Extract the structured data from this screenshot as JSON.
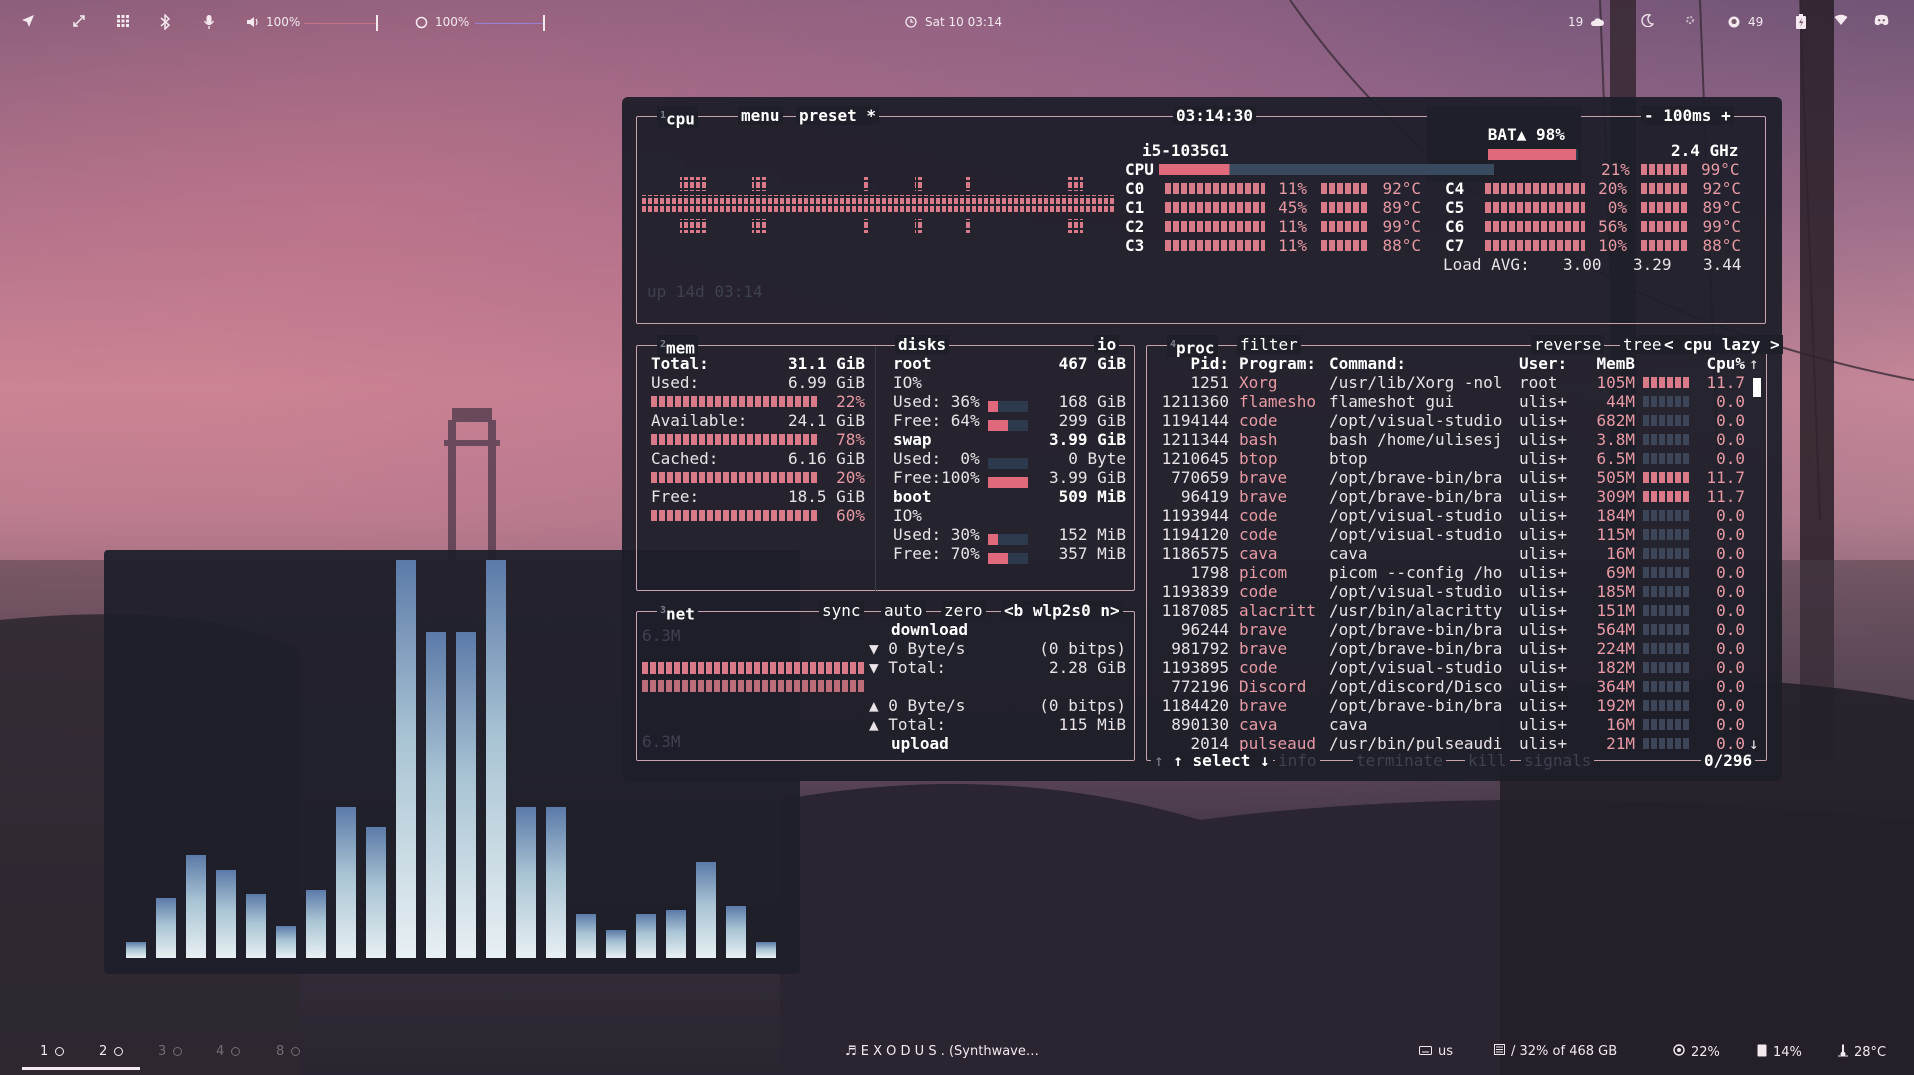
{
  "topbar": {
    "left_icons": [
      "location-arrow-icon",
      "expand-icon",
      "grid-icon",
      "bluetooth-icon",
      "microphone-icon"
    ],
    "volume": {
      "icon": "speaker-icon",
      "label": "100%",
      "level": 1.0,
      "color": "#c6738a"
    },
    "brightness": {
      "icon": "brightness-icon",
      "label": "100%",
      "level": 1.0,
      "color": "#9b7fd6"
    },
    "clock": {
      "icon": "clock-icon",
      "label": "Sat 10 03:14"
    },
    "right": {
      "weather_count": "19",
      "weather_icon": "cloud-icon",
      "moon_icon": "moon-icon",
      "settings_icon": "gear-icon",
      "github_icon": "github-icon",
      "github_count": "49",
      "battery_icon": "battery-charging-icon",
      "wifi_icon": "wifi-icon",
      "discord_icon": "discord-icon"
    }
  },
  "btop": {
    "cpu_box": {
      "title_num": "1",
      "title": "cpu",
      "menu": "menu",
      "preset": "preset *",
      "time": "03:14:30",
      "battery_label": "BAT▲ 98%",
      "battery_level": 0.98,
      "interval": "- 100ms +",
      "uptime": "up 14d 03:14",
      "cpu_model": "i5-1035G1",
      "freq": "2.4 GHz",
      "cpu_label": "CPU",
      "cpu_pct": "21%",
      "cpu_level": 0.21,
      "cpu_temp": "99°C",
      "cores": [
        {
          "name": "C0",
          "pct": "11%",
          "temp": "92°C"
        },
        {
          "name": "C1",
          "pct": "45%",
          "temp": "89°C"
        },
        {
          "name": "C2",
          "pct": "11%",
          "temp": "99°C"
        },
        {
          "name": "C3",
          "pct": "11%",
          "temp": "88°C"
        },
        {
          "name": "C4",
          "pct": "20%",
          "temp": "92°C"
        },
        {
          "name": "C5",
          "pct": "0%",
          "temp": "89°C"
        },
        {
          "name": "C6",
          "pct": "56%",
          "temp": "99°C"
        },
        {
          "name": "C7",
          "pct": "10%",
          "temp": "88°C"
        }
      ],
      "load_label": "Load AVG:",
      "load": [
        "3.00",
        "3.29",
        "3.44"
      ]
    },
    "mem_box": {
      "title_num": "2",
      "title": "mem",
      "rows": [
        {
          "label": "Total:",
          "value": "31.1 GiB",
          "pct": ""
        },
        {
          "label": "Used:",
          "value": "6.99 GiB",
          "pct": "22%"
        },
        {
          "label": "Available:",
          "value": "24.1 GiB",
          "pct": "78%"
        },
        {
          "label": "Cached:",
          "value": "6.16 GiB",
          "pct": "20%"
        },
        {
          "label": "Free:",
          "value": "18.5 GiB",
          "pct": "60%"
        }
      ]
    },
    "disks_box": {
      "title": "disks",
      "io": "io",
      "root": {
        "name": "root",
        "size": "467 GiB",
        "io": "IO%",
        "used": "Used: 36%",
        "used_val": "168 GiB",
        "free": "Free: 64%",
        "free_val": "299 GiB"
      },
      "swap": {
        "name": "swap",
        "size": "3.99 GiB",
        "used": "Used:  0%",
        "used_val": "0 Byte",
        "free": "Free:100%",
        "free_val": "3.99 GiB"
      },
      "boot": {
        "name": "boot",
        "size": "509 MiB",
        "io": "IO%",
        "used": "Used: 30%",
        "used_val": "152 MiB",
        "free": "Free: 70%",
        "free_val": "357 MiB"
      }
    },
    "net_box": {
      "title_num": "3",
      "title": "net",
      "sync": "sync",
      "auto": "auto",
      "zero": "zero",
      "iface": "<b wlp2s0 n>",
      "scale_top": "6.3M",
      "scale_bottom": "6.3M",
      "download": "download",
      "dl_rate": "▼ 0 Byte/s",
      "dl_bits": "(0 bitps)",
      "dl_total_label": "▼ Total:",
      "dl_total": "2.28 GiB",
      "ul_rate": "▲ 0 Byte/s",
      "ul_bits": "(0 bitps)",
      "ul_total_label": "▲ Total:",
      "ul_total": "115 MiB",
      "upload": "upload"
    },
    "proc_box": {
      "title_num": "4",
      "title": "proc",
      "filter": "filter",
      "reverse": "reverse",
      "tree": "tree",
      "sort": "< cpu lazy >",
      "headers": [
        "Pid:",
        "Program:",
        "Command:",
        "User:",
        "MemB",
        "Cpu%"
      ],
      "rows": [
        {
          "pid": "1251",
          "prog": "Xorg",
          "cmd": "/usr/lib/Xorg -nol",
          "user": "root",
          "mem": "105M",
          "cpu": "11.7"
        },
        {
          "pid": "1211360",
          "prog": "flamesho",
          "cmd": "flameshot gui",
          "user": "ulis+",
          "mem": "44M",
          "cpu": "0.0"
        },
        {
          "pid": "1194144",
          "prog": "code",
          "cmd": "/opt/visual-studio",
          "user": "ulis+",
          "mem": "682M",
          "cpu": "0.0"
        },
        {
          "pid": "1211344",
          "prog": "bash",
          "cmd": "bash /home/ulisesj",
          "user": "ulis+",
          "mem": "3.8M",
          "cpu": "0.0"
        },
        {
          "pid": "1210645",
          "prog": "btop",
          "cmd": "btop",
          "user": "ulis+",
          "mem": "6.5M",
          "cpu": "0.0"
        },
        {
          "pid": "770659",
          "prog": "brave",
          "cmd": "/opt/brave-bin/bra",
          "user": "ulis+",
          "mem": "505M",
          "cpu": "11.7"
        },
        {
          "pid": "96419",
          "prog": "brave",
          "cmd": "/opt/brave-bin/bra",
          "user": "ulis+",
          "mem": "309M",
          "cpu": "11.7"
        },
        {
          "pid": "1193944",
          "prog": "code",
          "cmd": "/opt/visual-studio",
          "user": "ulis+",
          "mem": "184M",
          "cpu": "0.0"
        },
        {
          "pid": "1194120",
          "prog": "code",
          "cmd": "/opt/visual-studio",
          "user": "ulis+",
          "mem": "115M",
          "cpu": "0.0"
        },
        {
          "pid": "1186575",
          "prog": "cava",
          "cmd": "cava",
          "user": "ulis+",
          "mem": "16M",
          "cpu": "0.0"
        },
        {
          "pid": "1798",
          "prog": "picom",
          "cmd": "picom --config /ho",
          "user": "ulis+",
          "mem": "69M",
          "cpu": "0.0"
        },
        {
          "pid": "1193839",
          "prog": "code",
          "cmd": "/opt/visual-studio",
          "user": "ulis+",
          "mem": "185M",
          "cpu": "0.0"
        },
        {
          "pid": "1187085",
          "prog": "alacritt",
          "cmd": "/usr/bin/alacritty",
          "user": "ulis+",
          "mem": "151M",
          "cpu": "0.0"
        },
        {
          "pid": "96244",
          "prog": "brave",
          "cmd": "/opt/brave-bin/bra",
          "user": "ulis+",
          "mem": "564M",
          "cpu": "0.0"
        },
        {
          "pid": "981792",
          "prog": "brave",
          "cmd": "/opt/brave-bin/bra",
          "user": "ulis+",
          "mem": "224M",
          "cpu": "0.0"
        },
        {
          "pid": "1193895",
          "prog": "code",
          "cmd": "/opt/visual-studio",
          "user": "ulis+",
          "mem": "182M",
          "cpu": "0.0"
        },
        {
          "pid": "772196",
          "prog": "Discord",
          "cmd": "/opt/discord/Disco",
          "user": "ulis+",
          "mem": "364M",
          "cpu": "0.0"
        },
        {
          "pid": "1184420",
          "prog": "brave",
          "cmd": "/opt/brave-bin/bra",
          "user": "ulis+",
          "mem": "192M",
          "cpu": "0.0"
        },
        {
          "pid": "890130",
          "prog": "cava",
          "cmd": "cava",
          "user": "ulis+",
          "mem": "16M",
          "cpu": "0.0"
        },
        {
          "pid": "2014",
          "prog": "pulseaud",
          "cmd": "/usr/bin/pulseaudi",
          "user": "ulis+",
          "mem": "21M",
          "cpu": "0.0"
        }
      ],
      "footer": {
        "select": "↑ select ↓",
        "info": "info",
        "terminate": "terminate",
        "kill": "kill",
        "signals": "signals",
        "count": "0/296"
      }
    }
  },
  "cava": {
    "levels": [
      0.04,
      0.15,
      0.26,
      0.22,
      0.16,
      0.08,
      0.17,
      0.38,
      0.33,
      1.0,
      0.82,
      0.82,
      1.0,
      0.38,
      0.38,
      0.11,
      0.07,
      0.11,
      0.12,
      0.24,
      0.13,
      0.04
    ],
    "color_top": "#5b7aa8",
    "color_bottom": "#e8f0f3"
  },
  "bottombar": {
    "workspaces": [
      "1",
      "2",
      "3",
      "4",
      "8"
    ],
    "active_workspaces": [
      0,
      1
    ],
    "music": "♬ E X O D U S  .  (Synthwave…",
    "keyboard_icon": "keyboard-icon",
    "keyboard": "us",
    "disk_icon": "disk-icon",
    "disk": "/ 32% of 468 GB",
    "cpu_icon": "cpu-icon",
    "cpu": "22%",
    "mem_icon": "memory-icon",
    "mem": "14%",
    "temp_icon": "thermometer-icon",
    "temp": "28°C"
  },
  "colors": {
    "term_bg": "#1e1f29",
    "box_border": "#c7a3ae",
    "bar_red": "#e06a7c",
    "bar_dark": "#3a4a5e",
    "pink_text": "#e89aa4"
  }
}
